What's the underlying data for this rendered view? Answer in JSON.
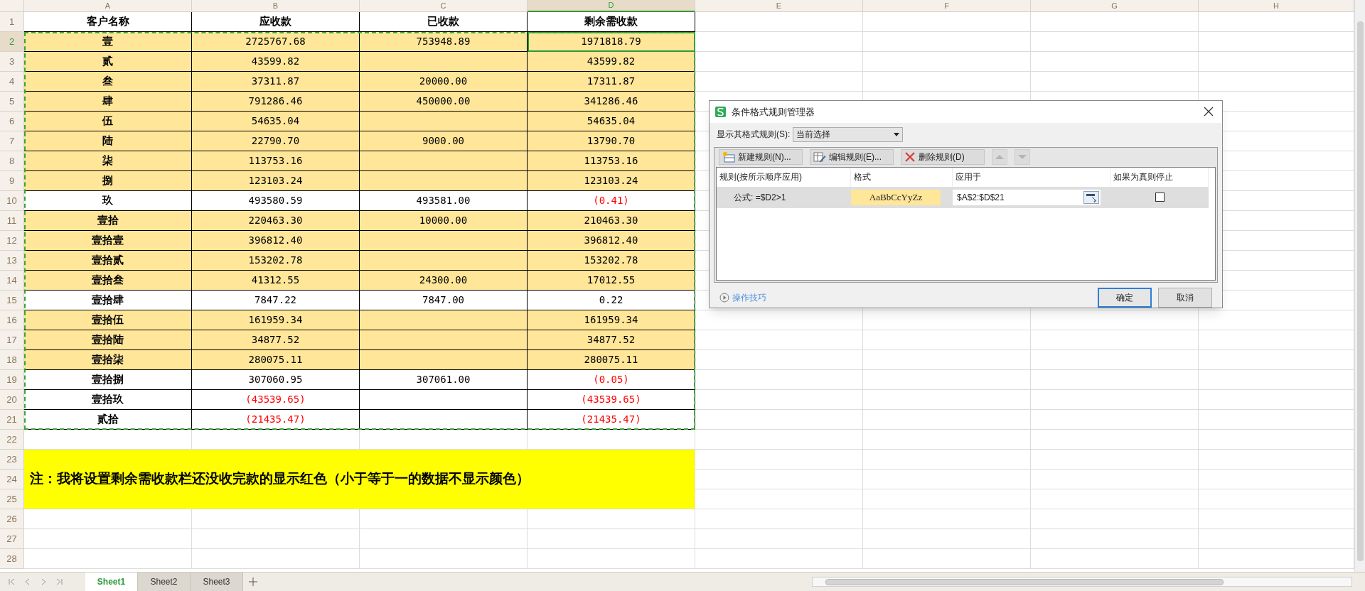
{
  "column_headers": [
    {
      "label": "A",
      "selected": false
    },
    {
      "label": "B",
      "selected": false
    },
    {
      "label": "C",
      "selected": false
    },
    {
      "label": "D",
      "selected": true
    },
    {
      "label": "E",
      "selected": false
    },
    {
      "label": "F",
      "selected": false
    },
    {
      "label": "G",
      "selected": false
    },
    {
      "label": "H",
      "selected": false
    }
  ],
  "header_row": {
    "row_label": "1",
    "cells": [
      "客户名称",
      "应收款",
      "已收款",
      "剩余需收款"
    ]
  },
  "data_rows": [
    {
      "row_label": "2",
      "selected": true,
      "highlighted": true,
      "name": "壹",
      "receivable": {
        "text": "2725767.68",
        "negative": false
      },
      "received": {
        "text": "753948.89",
        "negative": false
      },
      "remaining": {
        "text": "1971818.79",
        "negative": false
      }
    },
    {
      "row_label": "3",
      "selected": false,
      "highlighted": true,
      "name": "贰",
      "receivable": {
        "text": "43599.82",
        "negative": false
      },
      "remaining": {
        "text": "43599.82",
        "negative": false
      }
    },
    {
      "row_label": "4",
      "selected": false,
      "highlighted": true,
      "name": "叁",
      "receivable": {
        "text": "37311.87",
        "negative": false
      },
      "received": {
        "text": "20000.00",
        "negative": false
      },
      "remaining": {
        "text": "17311.87",
        "negative": false
      }
    },
    {
      "row_label": "5",
      "selected": false,
      "highlighted": true,
      "name": "肆",
      "receivable": {
        "text": "791286.46",
        "negative": false
      },
      "received": {
        "text": "450000.00",
        "negative": false
      },
      "remaining": {
        "text": "341286.46",
        "negative": false
      }
    },
    {
      "row_label": "6",
      "selected": false,
      "highlighted": true,
      "name": "伍",
      "receivable": {
        "text": "54635.04",
        "negative": false
      },
      "remaining": {
        "text": "54635.04",
        "negative": false
      }
    },
    {
      "row_label": "7",
      "selected": false,
      "highlighted": true,
      "name": "陆",
      "receivable": {
        "text": "22790.70",
        "negative": false
      },
      "received": {
        "text": "9000.00",
        "negative": false
      },
      "remaining": {
        "text": "13790.70",
        "negative": false
      }
    },
    {
      "row_label": "8",
      "selected": false,
      "highlighted": true,
      "name": "柒",
      "receivable": {
        "text": "113753.16",
        "negative": false
      },
      "remaining": {
        "text": "113753.16",
        "negative": false
      }
    },
    {
      "row_label": "9",
      "selected": false,
      "highlighted": true,
      "name": "捌",
      "receivable": {
        "text": "123103.24",
        "negative": false
      },
      "remaining": {
        "text": "123103.24",
        "negative": false
      }
    },
    {
      "row_label": "10",
      "selected": false,
      "highlighted": false,
      "name": "玖",
      "receivable": {
        "text": "493580.59",
        "negative": false
      },
      "received": {
        "text": "493581.00",
        "negative": false
      },
      "remaining": {
        "text": "(0.41)",
        "negative": true
      }
    },
    {
      "row_label": "11",
      "selected": false,
      "highlighted": true,
      "name": "壹拾",
      "receivable": {
        "text": "220463.30",
        "negative": false
      },
      "received": {
        "text": "10000.00",
        "negative": false
      },
      "remaining": {
        "text": "210463.30",
        "negative": false
      }
    },
    {
      "row_label": "12",
      "selected": false,
      "highlighted": true,
      "name": "壹拾壹",
      "receivable": {
        "text": "396812.40",
        "negative": false
      },
      "remaining": {
        "text": "396812.40",
        "negative": false
      }
    },
    {
      "row_label": "13",
      "selected": false,
      "highlighted": true,
      "name": "壹拾贰",
      "receivable": {
        "text": "153202.78",
        "negative": false
      },
      "remaining": {
        "text": "153202.78",
        "negative": false
      }
    },
    {
      "row_label": "14",
      "selected": false,
      "highlighted": true,
      "name": "壹拾叁",
      "receivable": {
        "text": "41312.55",
        "negative": false
      },
      "received": {
        "text": "24300.00",
        "negative": false
      },
      "remaining": {
        "text": "17012.55",
        "negative": false
      }
    },
    {
      "row_label": "15",
      "selected": false,
      "highlighted": false,
      "name": "壹拾肆",
      "receivable": {
        "text": "7847.22",
        "negative": false
      },
      "received": {
        "text": "7847.00",
        "negative": false
      },
      "remaining": {
        "text": "0.22",
        "negative": false
      }
    },
    {
      "row_label": "16",
      "selected": false,
      "highlighted": true,
      "name": "壹拾伍",
      "receivable": {
        "text": "161959.34",
        "negative": false
      },
      "remaining": {
        "text": "161959.34",
        "negative": false
      }
    },
    {
      "row_label": "17",
      "selected": false,
      "highlighted": true,
      "name": "壹拾陆",
      "receivable": {
        "text": "34877.52",
        "negative": false
      },
      "remaining": {
        "text": "34877.52",
        "negative": false
      }
    },
    {
      "row_label": "18",
      "selected": false,
      "highlighted": true,
      "name": "壹拾柒",
      "receivable": {
        "text": "280075.11",
        "negative": false
      },
      "remaining": {
        "text": "280075.11",
        "negative": false
      }
    },
    {
      "row_label": "19",
      "selected": false,
      "highlighted": false,
      "name": "壹拾捌",
      "receivable": {
        "text": "307060.95",
        "negative": false
      },
      "received": {
        "text": "307061.00",
        "negative": false
      },
      "remaining": {
        "text": "(0.05)",
        "negative": true
      }
    },
    {
      "row_label": "20",
      "selected": false,
      "highlighted": false,
      "name": "壹拾玖",
      "receivable": {
        "text": "(43539.65)",
        "negative": true
      },
      "remaining": {
        "text": "(43539.65)",
        "negative": true
      }
    },
    {
      "row_label": "21",
      "selected": false,
      "highlighted": false,
      "name": "贰拾",
      "receivable": {
        "text": "(21435.47)",
        "negative": true
      },
      "remaining": {
        "text": "(21435.47)",
        "negative": true
      }
    }
  ],
  "empty_rows_before_note": [
    "22"
  ],
  "note": {
    "row_labels": [
      "23",
      "24",
      "25"
    ],
    "text": "注：我将设置剩余需收款栏还没收完款的显示红色（小于等于一的数据不显示颜色）"
  },
  "empty_rows_after_note": [
    "26",
    "27",
    "28"
  ],
  "sheet_tabs": [
    {
      "label": "Sheet1",
      "selected": true
    },
    {
      "label": "Sheet2",
      "selected": false
    },
    {
      "label": "Sheet3",
      "selected": false
    }
  ],
  "dialog": {
    "title": "条件格式规则管理器",
    "show_rules_label": "显示其格式规则(S):",
    "show_rules_value": "当前选择",
    "toolbar": [
      {
        "kind": "new",
        "label": "新建规则(N)..."
      },
      {
        "kind": "edit",
        "label": "编辑规则(E)..."
      },
      {
        "kind": "delete",
        "label": "删除规则(D)"
      }
    ],
    "move_buttons": [
      {
        "kind": "up",
        "disabled": true
      },
      {
        "kind": "down",
        "disabled": true
      }
    ],
    "columns": [
      "规则(按所示顺序应用)",
      "格式",
      "应用于",
      "如果为真则停止"
    ],
    "rules": [
      {
        "rule": "公式: =$D2>1",
        "format_preview": "AaBbCcYyZz",
        "applies_to": "$A$2:$D$21",
        "stop_if_true": false,
        "selected": true
      }
    ],
    "tips_link": "操作技巧",
    "buttons": [
      {
        "kind": "primary",
        "label": "确定"
      },
      {
        "kind": "secondary",
        "label": "取消"
      }
    ]
  }
}
